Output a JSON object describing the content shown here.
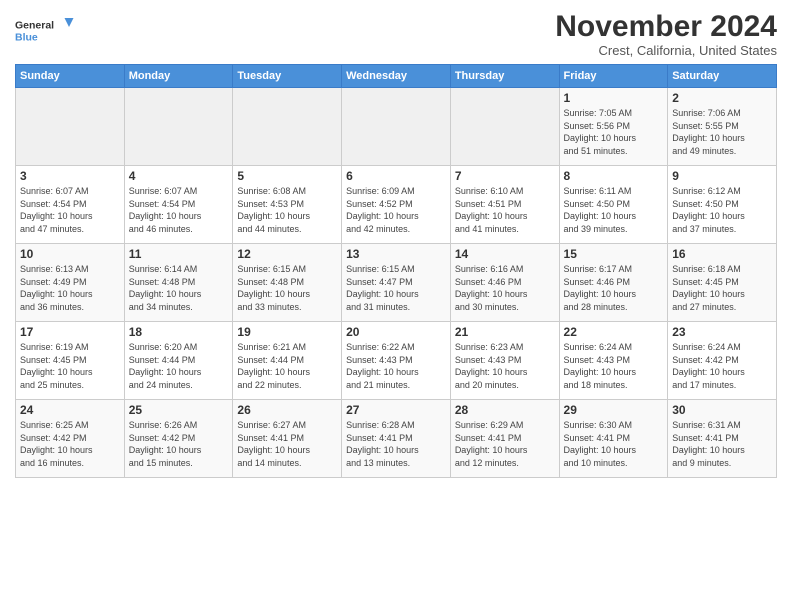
{
  "logo": {
    "line1": "General",
    "line2": "Blue"
  },
  "title": "November 2024",
  "subtitle": "Crest, California, United States",
  "headers": [
    "Sunday",
    "Monday",
    "Tuesday",
    "Wednesday",
    "Thursday",
    "Friday",
    "Saturday"
  ],
  "weeks": [
    [
      {
        "num": "",
        "info": ""
      },
      {
        "num": "",
        "info": ""
      },
      {
        "num": "",
        "info": ""
      },
      {
        "num": "",
        "info": ""
      },
      {
        "num": "",
        "info": ""
      },
      {
        "num": "1",
        "info": "Sunrise: 7:05 AM\nSunset: 5:56 PM\nDaylight: 10 hours\nand 51 minutes."
      },
      {
        "num": "2",
        "info": "Sunrise: 7:06 AM\nSunset: 5:55 PM\nDaylight: 10 hours\nand 49 minutes."
      }
    ],
    [
      {
        "num": "3",
        "info": "Sunrise: 6:07 AM\nSunset: 4:54 PM\nDaylight: 10 hours\nand 47 minutes."
      },
      {
        "num": "4",
        "info": "Sunrise: 6:07 AM\nSunset: 4:54 PM\nDaylight: 10 hours\nand 46 minutes."
      },
      {
        "num": "5",
        "info": "Sunrise: 6:08 AM\nSunset: 4:53 PM\nDaylight: 10 hours\nand 44 minutes."
      },
      {
        "num": "6",
        "info": "Sunrise: 6:09 AM\nSunset: 4:52 PM\nDaylight: 10 hours\nand 42 minutes."
      },
      {
        "num": "7",
        "info": "Sunrise: 6:10 AM\nSunset: 4:51 PM\nDaylight: 10 hours\nand 41 minutes."
      },
      {
        "num": "8",
        "info": "Sunrise: 6:11 AM\nSunset: 4:50 PM\nDaylight: 10 hours\nand 39 minutes."
      },
      {
        "num": "9",
        "info": "Sunrise: 6:12 AM\nSunset: 4:50 PM\nDaylight: 10 hours\nand 37 minutes."
      }
    ],
    [
      {
        "num": "10",
        "info": "Sunrise: 6:13 AM\nSunset: 4:49 PM\nDaylight: 10 hours\nand 36 minutes."
      },
      {
        "num": "11",
        "info": "Sunrise: 6:14 AM\nSunset: 4:48 PM\nDaylight: 10 hours\nand 34 minutes."
      },
      {
        "num": "12",
        "info": "Sunrise: 6:15 AM\nSunset: 4:48 PM\nDaylight: 10 hours\nand 33 minutes."
      },
      {
        "num": "13",
        "info": "Sunrise: 6:15 AM\nSunset: 4:47 PM\nDaylight: 10 hours\nand 31 minutes."
      },
      {
        "num": "14",
        "info": "Sunrise: 6:16 AM\nSunset: 4:46 PM\nDaylight: 10 hours\nand 30 minutes."
      },
      {
        "num": "15",
        "info": "Sunrise: 6:17 AM\nSunset: 4:46 PM\nDaylight: 10 hours\nand 28 minutes."
      },
      {
        "num": "16",
        "info": "Sunrise: 6:18 AM\nSunset: 4:45 PM\nDaylight: 10 hours\nand 27 minutes."
      }
    ],
    [
      {
        "num": "17",
        "info": "Sunrise: 6:19 AM\nSunset: 4:45 PM\nDaylight: 10 hours\nand 25 minutes."
      },
      {
        "num": "18",
        "info": "Sunrise: 6:20 AM\nSunset: 4:44 PM\nDaylight: 10 hours\nand 24 minutes."
      },
      {
        "num": "19",
        "info": "Sunrise: 6:21 AM\nSunset: 4:44 PM\nDaylight: 10 hours\nand 22 minutes."
      },
      {
        "num": "20",
        "info": "Sunrise: 6:22 AM\nSunset: 4:43 PM\nDaylight: 10 hours\nand 21 minutes."
      },
      {
        "num": "21",
        "info": "Sunrise: 6:23 AM\nSunset: 4:43 PM\nDaylight: 10 hours\nand 20 minutes."
      },
      {
        "num": "22",
        "info": "Sunrise: 6:24 AM\nSunset: 4:43 PM\nDaylight: 10 hours\nand 18 minutes."
      },
      {
        "num": "23",
        "info": "Sunrise: 6:24 AM\nSunset: 4:42 PM\nDaylight: 10 hours\nand 17 minutes."
      }
    ],
    [
      {
        "num": "24",
        "info": "Sunrise: 6:25 AM\nSunset: 4:42 PM\nDaylight: 10 hours\nand 16 minutes."
      },
      {
        "num": "25",
        "info": "Sunrise: 6:26 AM\nSunset: 4:42 PM\nDaylight: 10 hours\nand 15 minutes."
      },
      {
        "num": "26",
        "info": "Sunrise: 6:27 AM\nSunset: 4:41 PM\nDaylight: 10 hours\nand 14 minutes."
      },
      {
        "num": "27",
        "info": "Sunrise: 6:28 AM\nSunset: 4:41 PM\nDaylight: 10 hours\nand 13 minutes."
      },
      {
        "num": "28",
        "info": "Sunrise: 6:29 AM\nSunset: 4:41 PM\nDaylight: 10 hours\nand 12 minutes."
      },
      {
        "num": "29",
        "info": "Sunrise: 6:30 AM\nSunset: 4:41 PM\nDaylight: 10 hours\nand 10 minutes."
      },
      {
        "num": "30",
        "info": "Sunrise: 6:31 AM\nSunset: 4:41 PM\nDaylight: 10 hours\nand 9 minutes."
      }
    ]
  ]
}
